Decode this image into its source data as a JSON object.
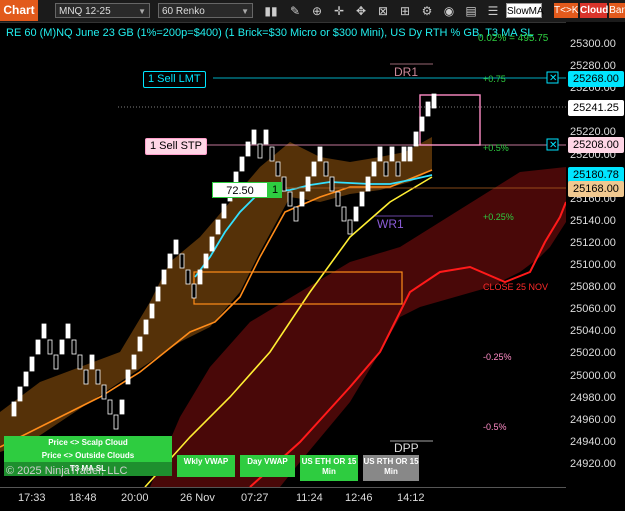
{
  "toolbar": {
    "chart_tab": "Chart",
    "instrument": "MNQ 12-25",
    "period": "60 Renko",
    "indicator": "SlowMA",
    "tk_label": "T<>K",
    "cloud_label": "Cloud",
    "bar_label": "Bar"
  },
  "info_line": "RE 60 (M)NQ June 23 GB (1%=200p=$400) (1 Brick=$30 Micro or $300 Mini), US Dy RTH % GB, T3 MA SL",
  "info_suffix": "0.02% = 495.75",
  "orders": {
    "sell_limit": "1 Sell LMT",
    "sell_stop": "1 Sell STP",
    "position_price": "72.50",
    "position_qty": "1"
  },
  "levels": {
    "dr1": "DR1",
    "wr1": "WR1",
    "dpp": "DPP",
    "pct_p075": "+0.75",
    "pct_p05": "+0.5%",
    "pct_p025": "+0.25%",
    "close": "CLOSE 25 NOV",
    "pct_m025": "-0.25%",
    "pct_m05": "-0.5%"
  },
  "y_ticks": [
    "25300.00",
    "25280.00",
    "25260.00",
    "25240.00",
    "25220.00",
    "25200.00",
    "25180.00",
    "25160.00",
    "25140.00",
    "25120.00",
    "25100.00",
    "25080.00",
    "25060.00",
    "25040.00",
    "25020.00",
    "25000.00",
    "24980.00",
    "24960.00",
    "24940.00",
    "24920.00"
  ],
  "price_labels": {
    "sell_limit": "25268.00",
    "last": "25241.25",
    "sell_stop": "25208.00",
    "ma": "25180.78",
    "close": "25168.00"
  },
  "x_ticks": [
    "17:33",
    "18:48",
    "20:00",
    "26 Nov",
    "07:27",
    "11:24",
    "12:46",
    "14:12"
  ],
  "buttons": {
    "scalp_cloud": "Price <> Scalp Cloud",
    "outside_clouds": "Price <> Outside Clouds",
    "t3_ma": "T3 MA SL",
    "wkly_vwap": "Wkly VWAP",
    "day_vwap": "Day VWAP",
    "us_eth": "US ETH OR 15 Min",
    "us_rth": "US RTH OR 15 Min"
  },
  "copyright": "© 2025 NinjaTrader, LLC",
  "colors": {
    "accent": "#e25a1c",
    "cyan": "#00e5ff",
    "pink": "#ff9ecb",
    "green_button": "#2ecc40",
    "cloud_orange": "#a05a10",
    "cloud_red": "#5a0a0a",
    "yellow_ma": "#ffee33"
  }
}
